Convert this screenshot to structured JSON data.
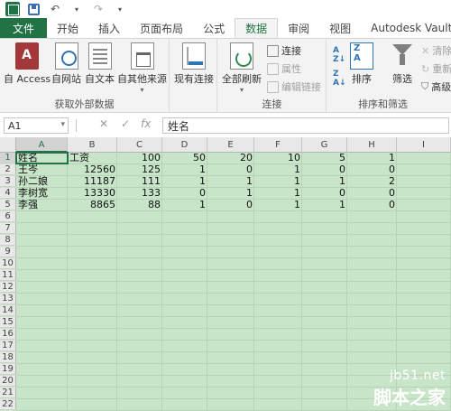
{
  "tabs": [
    "文件",
    "开始",
    "插入",
    "页面布局",
    "公式",
    "数据",
    "审阅",
    "视图",
    "Autodesk Vault(K)"
  ],
  "active_tab": "数据",
  "ribbon": {
    "get_external": {
      "label": "获取外部数据",
      "buttons": [
        "自 Access",
        "自网站",
        "自文本",
        "自其他来源"
      ]
    },
    "existing_label": "现有连接",
    "connections": {
      "label": "连接",
      "refresh_all": "全部刷新",
      "connections_btn": "连接",
      "properties_btn": "属性",
      "edit_links_btn": "编辑链接"
    },
    "sort_filter": {
      "label": "排序和筛选",
      "sort_btn": "排序",
      "filter_btn": "筛选",
      "clear_btn": "清除",
      "reapply_btn": "重新",
      "advanced_btn": "高级"
    }
  },
  "formula_bar": {
    "name_box": "A1",
    "content": "姓名"
  },
  "columns": [
    "A",
    "B",
    "C",
    "D",
    "E",
    "F",
    "G",
    "H",
    "I"
  ],
  "rows": [
    "1",
    "2",
    "3",
    "4",
    "5",
    "6",
    "7",
    "8",
    "9",
    "10",
    "11",
    "12",
    "13",
    "14",
    "15",
    "16",
    "17",
    "18",
    "19",
    "20",
    "21",
    "22"
  ],
  "cells": [
    [
      "姓名",
      "工资",
      "100",
      "50",
      "20",
      "10",
      "5",
      "1"
    ],
    [
      "王岑",
      "12560",
      "125",
      "1",
      "0",
      "1",
      "0",
      "0"
    ],
    [
      "孙二娘",
      "11187",
      "111",
      "1",
      "1",
      "1",
      "1",
      "2"
    ],
    [
      "李树宽",
      "13330",
      "133",
      "0",
      "1",
      "1",
      "0",
      "0"
    ],
    [
      "李强",
      "8865",
      "88",
      "1",
      "0",
      "1",
      "1",
      "0"
    ]
  ],
  "watermark": {
    "url": "jb51.net",
    "name": "脚本之家"
  }
}
